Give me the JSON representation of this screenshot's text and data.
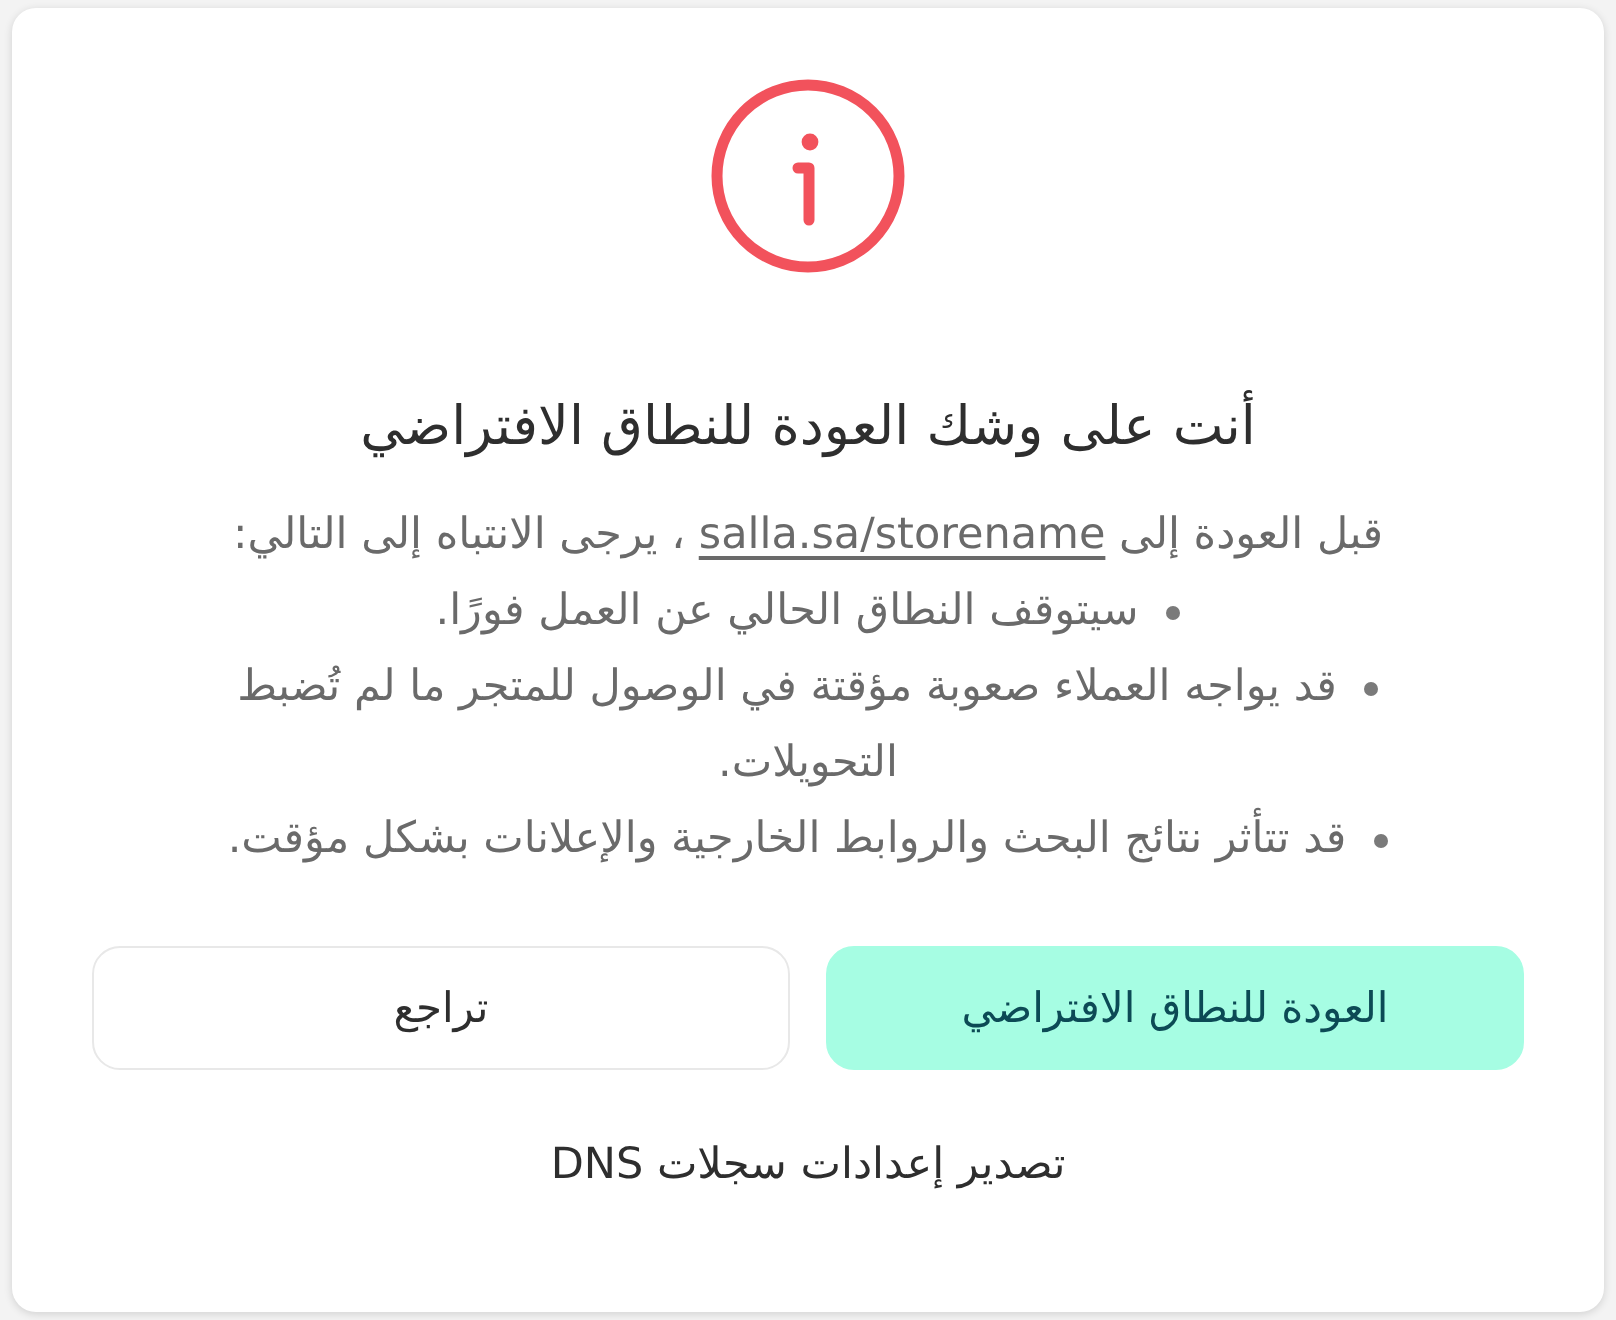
{
  "dialog": {
    "title": "أنت على وشك العودة للنطاق الافتراضي",
    "intro": {
      "before": "قبل العودة إلى",
      "link": "salla.sa/storename",
      "after": "، يرجى الانتباه إلى التالي:"
    },
    "points": [
      "سيتوقف النطاق الحالي عن العمل فورًا.",
      "قد يواجه العملاء صعوبة مؤقتة في الوصول للمتجر ما لم تُضبط التحويلات.",
      "قد تتأثر نتائج البحث والروابط الخارجية والإعلانات بشكل مؤقت."
    ],
    "buttons": [
      {
        "label": "العودة للنطاق الافتراضي",
        "kind": "primary"
      },
      {
        "label": "تراجع",
        "kind": "secondary"
      }
    ],
    "export_link": "تصدير إعدادات سجلات DNS"
  }
}
